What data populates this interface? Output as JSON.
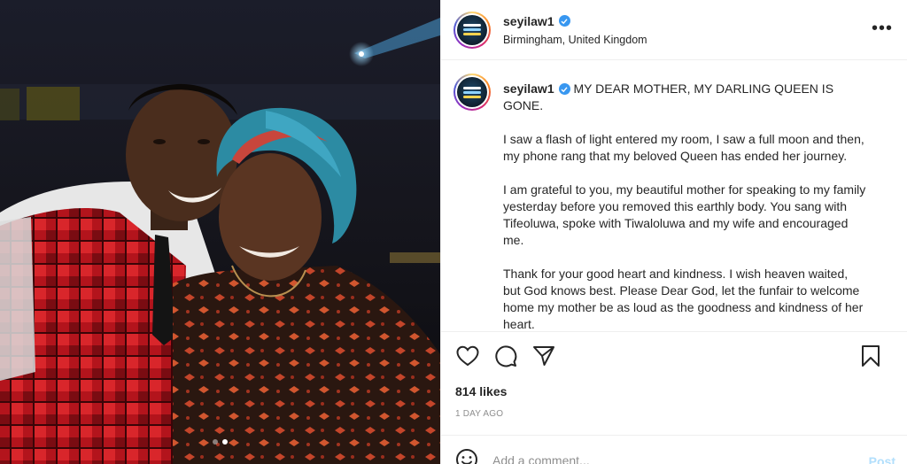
{
  "post": {
    "username": "seyilaw1",
    "verified": true,
    "location": "Birmingham, United Kingdom",
    "more_label": "•••",
    "carousel": {
      "count": 2,
      "active": 2
    }
  },
  "caption": {
    "username": "seyilaw1",
    "title": "MY DEAR MOTHER, MY DARLING QUEEN IS GONE.",
    "paragraphs": [
      "I saw a flash of light entered my room, I saw a full moon and then, my phone rang that my beloved Queen has ended her journey.",
      "I am grateful to you, my beautiful mother for speaking to my family yesterday before you removed this earthly body. You sang with Tifeoluwa, spoke with Tiwaloluwa and my wife and encouraged me.",
      "Thank for your good heart and kindness. I wish heaven waited, but God knows best. Please Dear God, let the funfair to welcome home my mother be as loud as the goodness and kindness of her heart."
    ]
  },
  "actions": {
    "like_icon": "heart-icon",
    "comment_icon": "comment-icon",
    "share_icon": "share-icon",
    "save_icon": "bookmark-icon"
  },
  "likes": "814 likes",
  "timestamp": "1 DAY AGO",
  "comment": {
    "placeholder": "Add a comment...",
    "post_label": "Post",
    "emoji_icon": "smiley-icon"
  },
  "colors": {
    "verified": "#3897f0",
    "post_button_disabled": "#b2dffc",
    "meta_text": "#8e8e8e",
    "divider": "#efefef"
  }
}
